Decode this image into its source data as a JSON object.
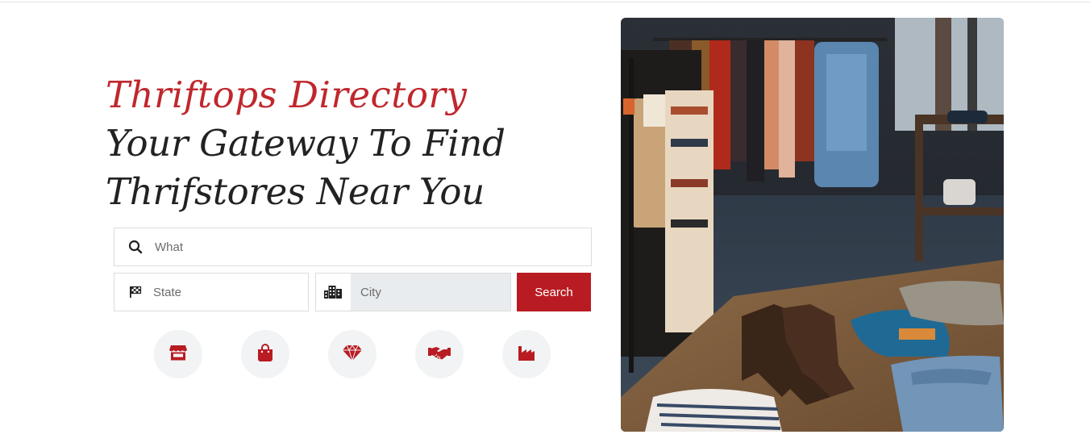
{
  "hero": {
    "brand": "Thriftops Directory",
    "line1": "Your Gateway To Find",
    "line2": "Thrifstores Near You"
  },
  "search": {
    "what_placeholder": "What",
    "state_placeholder": "State",
    "city_placeholder": "City",
    "button_label": "Search"
  },
  "categories": [
    {
      "icon": "store-icon"
    },
    {
      "icon": "shopping-bag-icon"
    },
    {
      "icon": "gem-icon"
    },
    {
      "icon": "handshake-icon"
    },
    {
      "icon": "factory-icon"
    }
  ],
  "colors": {
    "accent": "#b81c22",
    "brand_text": "#c0272d",
    "heading_text": "#222222",
    "category_bg": "#f1f3f4"
  }
}
